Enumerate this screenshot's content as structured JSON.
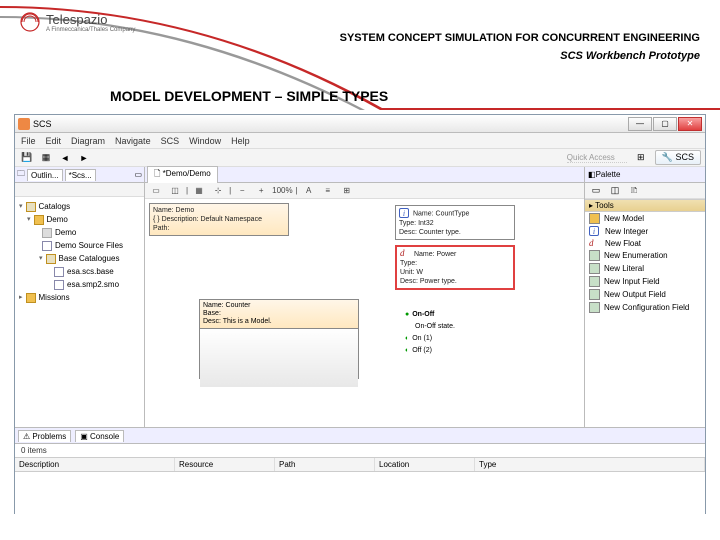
{
  "logo": {
    "name": "Telespazio",
    "sub": "A Finmeccanica/Thales Company"
  },
  "titles": {
    "main": "SYSTEM CONCEPT SIMULATION FOR CONCURRENT ENGINEERING",
    "sub": "SCS Workbench Prototype",
    "section": "MODEL DEVELOPMENT – SIMPLE TYPES"
  },
  "window": {
    "title": "SCS"
  },
  "menu": [
    "File",
    "Edit",
    "Diagram",
    "Navigate",
    "SCS",
    "Window",
    "Help"
  ],
  "quick_access": "Quick Access",
  "perspective": "SCS",
  "outline": {
    "tabs": [
      "Outlin...",
      "*Scs..."
    ],
    "rows": [
      {
        "level": 0,
        "icon": "open",
        "tri": "▾",
        "label": "Catalogs"
      },
      {
        "level": 1,
        "icon": "folder",
        "tri": "▾",
        "label": "Demo"
      },
      {
        "level": 2,
        "icon": "box",
        "tri": "",
        "label": "Demo"
      },
      {
        "level": 2,
        "icon": "doc",
        "tri": "",
        "label": "Demo Source Files"
      },
      {
        "level": 2,
        "icon": "open",
        "tri": "▾",
        "label": "Base Catalogues"
      },
      {
        "level": 3,
        "icon": "doc",
        "tri": "",
        "label": "esa.scs.base"
      },
      {
        "level": 3,
        "icon": "doc",
        "tri": "",
        "label": "esa.smp2.smo"
      },
      {
        "level": 0,
        "icon": "folder",
        "tri": "▸",
        "label": "Missions"
      }
    ]
  },
  "editor": {
    "tab": "*Demo/Demo",
    "zoom": "100%",
    "namespace": {
      "l1": "Name: Demo",
      "l2": "Description: Default Namespace",
      "l3": "Path:"
    },
    "counttype": {
      "l1": "Name: CountType",
      "l2": "Type: Int32",
      "l3": "Desc: Counter type."
    },
    "power": {
      "l1": "Name: Power",
      "l2": "Type:",
      "l3": "Unit: W",
      "l4": "Desc: Power type."
    },
    "onoff": {
      "head": "On-Off",
      "sub": "On-Off state.",
      "on": "On (1)",
      "off": "Off (2)"
    },
    "model": {
      "l1": "Name: Counter",
      "l2": "Base:",
      "l3": "Desc: This is a Model."
    }
  },
  "palette": {
    "title": "Palette",
    "section": "Tools",
    "items": [
      {
        "icon": "m",
        "label": "New Model"
      },
      {
        "icon": "i",
        "label": "New Integer"
      },
      {
        "icon": "d",
        "label": "New Float"
      },
      {
        "icon": "b",
        "label": "New Enumeration"
      },
      {
        "icon": "b",
        "label": "New Literal"
      },
      {
        "icon": "b",
        "label": "New Input Field"
      },
      {
        "icon": "b",
        "label": "New Output Field"
      },
      {
        "icon": "b",
        "label": "New Configuration Field"
      }
    ]
  },
  "problems": {
    "tabs": [
      "Problems",
      "Console"
    ],
    "count": "0 items",
    "columns": [
      "Description",
      "Resource",
      "Path",
      "Location",
      "Type"
    ]
  }
}
